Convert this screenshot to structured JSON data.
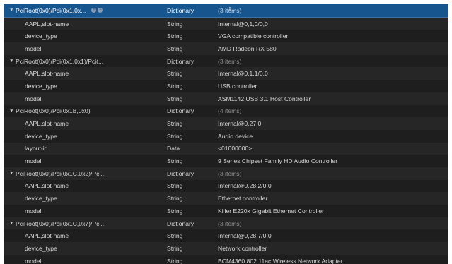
{
  "rows": [
    {
      "kind": "parent",
      "key": "PciRoot(0x0)/Pci(0x1,0x...",
      "type": "Dictionary",
      "value": "(3 items)",
      "selected": true
    },
    {
      "kind": "child",
      "key": "AAPL,slot-name",
      "type": "String",
      "value": "Internal@0,1,0/0,0"
    },
    {
      "kind": "child",
      "key": "device_type",
      "type": "String",
      "value": "VGA compatible controller"
    },
    {
      "kind": "child",
      "key": "model",
      "type": "String",
      "value": "AMD Radeon RX 580"
    },
    {
      "kind": "parent",
      "key": "PciRoot(0x0)/Pci(0x1,0x1)/Pci(...",
      "type": "Dictionary",
      "value": "(3 items)"
    },
    {
      "kind": "child",
      "key": "AAPL,slot-name",
      "type": "String",
      "value": "Internal@0,1,1/0,0"
    },
    {
      "kind": "child",
      "key": "device_type",
      "type": "String",
      "value": "USB controller"
    },
    {
      "kind": "child",
      "key": "model",
      "type": "String",
      "value": "ASM1142 USB 3.1 Host Controller"
    },
    {
      "kind": "parent",
      "key": "PciRoot(0x0)/Pci(0x1B,0x0)",
      "type": "Dictionary",
      "value": "(4 items)"
    },
    {
      "kind": "child",
      "key": "AAPL,slot-name",
      "type": "String",
      "value": "Internal@0,27,0"
    },
    {
      "kind": "child",
      "key": "device_type",
      "type": "String",
      "value": "Audio device"
    },
    {
      "kind": "child",
      "key": "layout-id",
      "type": "Data",
      "value": "<01000000>"
    },
    {
      "kind": "child",
      "key": "model",
      "type": "String",
      "value": "9 Series Chipset Family HD Audio Controller"
    },
    {
      "kind": "parent",
      "key": "PciRoot(0x0)/Pci(0x1C,0x2)/Pci...",
      "type": "Dictionary",
      "value": "(3 items)"
    },
    {
      "kind": "child",
      "key": "AAPL,slot-name",
      "type": "String",
      "value": "Internal@0,28,2/0,0"
    },
    {
      "kind": "child",
      "key": "device_type",
      "type": "String",
      "value": "Ethernet controller"
    },
    {
      "kind": "child",
      "key": "model",
      "type": "String",
      "value": "Killer E220x Gigabit Ethernet Controller"
    },
    {
      "kind": "parent",
      "key": "PciRoot(0x0)/Pci(0x1C,0x7)/Pci...",
      "type": "Dictionary",
      "value": "(3 items)"
    },
    {
      "kind": "child",
      "key": "AAPL,slot-name",
      "type": "String",
      "value": "Internal@0,28,7/0,0"
    },
    {
      "kind": "child",
      "key": "device_type",
      "type": "String",
      "value": "Network controller"
    },
    {
      "kind": "child",
      "key": "model",
      "type": "String",
      "value": "BCM4360 802.11ac Wireless Network Adapter"
    }
  ],
  "glyphs": {
    "disclosure": "▼",
    "type_arrows": "⇕",
    "add": "+",
    "remove": "−"
  },
  "colors": {
    "background": "#1e1e1e",
    "row_alt": "#262626",
    "selection": "#17558e",
    "text": "#d6d6d6",
    "dim_text": "#8e8e8e"
  }
}
